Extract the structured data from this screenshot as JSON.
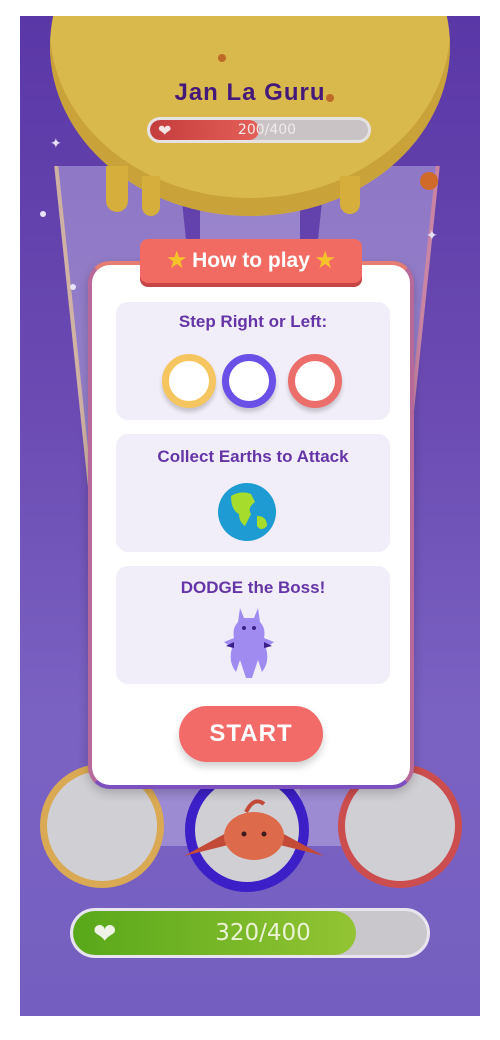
{
  "boss": {
    "name": "Jan La Guru",
    "hp_text": "200/400",
    "hp_fraction": 0.5
  },
  "how_to_play": {
    "title": "How to play",
    "sections": [
      {
        "title": "Step Right or Left:"
      },
      {
        "title": "Collect Earths to Attack"
      },
      {
        "title": "DODGE the Boss!"
      }
    ],
    "start_label": "START"
  },
  "player": {
    "hp_text": "320/400",
    "hp_fraction": 0.8
  },
  "colors": {
    "background": "#6c4cb3",
    "accent": "#f26b63",
    "ring_left": "#f5c65f",
    "ring_mid": "#6b50e8",
    "ring_right": "#ec6e6b",
    "boss": "#d9b94c"
  },
  "icons": [
    "heart-icon",
    "star-icon",
    "earth-icon",
    "boss-icon",
    "player-character-icon"
  ]
}
